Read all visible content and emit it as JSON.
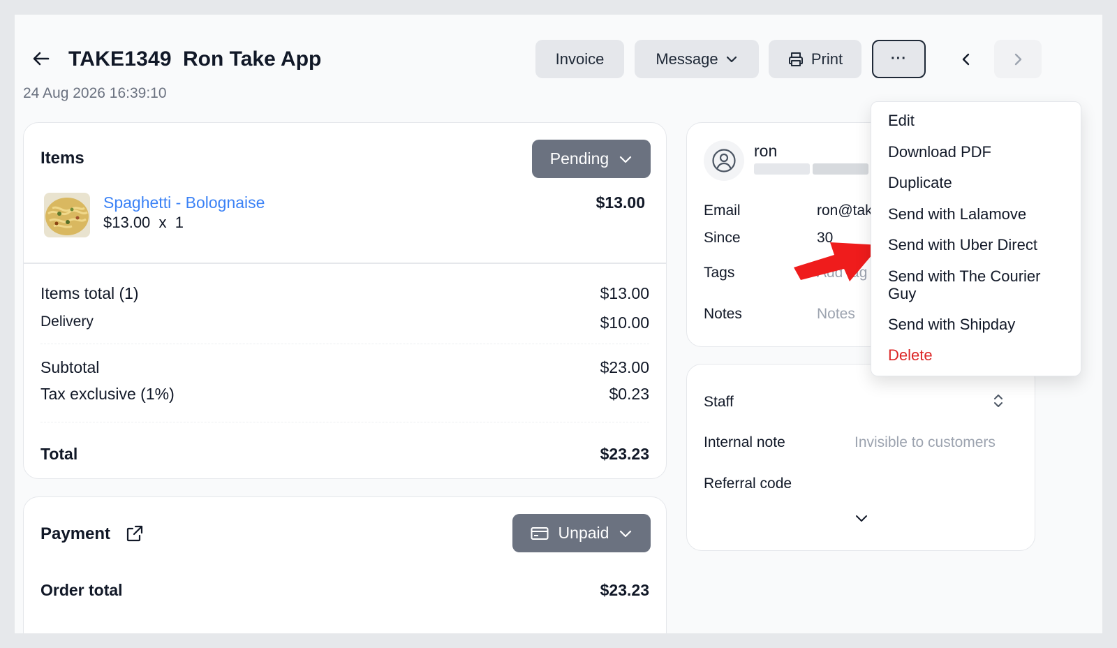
{
  "header": {
    "order_id": "TAKE1349",
    "customer_name": "Ron Take App",
    "date": "24 Aug 2026 16:39:10",
    "buttons": {
      "invoice": "Invoice",
      "message": "Message",
      "print": "Print",
      "more": "···"
    }
  },
  "items": {
    "title": "Items",
    "status": "Pending",
    "product": {
      "name": "Spaghetti - Bolognaise",
      "qty_line": "$13.00  x  1",
      "price": "$13.00"
    },
    "summary": {
      "items_total_label": "Items total (1)",
      "items_total_value": "$13.00",
      "delivery_label": "Delivery",
      "delivery_value": "$10.00",
      "subtotal_label": "Subtotal",
      "subtotal_value": "$23.00",
      "tax_label": "Tax exclusive (1%)",
      "tax_value": "$0.23",
      "total_label": "Total",
      "total_value": "$23.23"
    }
  },
  "payment": {
    "title": "Payment",
    "status": "Unpaid",
    "order_total_label": "Order total",
    "order_total_value": "$23.23"
  },
  "customer": {
    "name": "ron",
    "email_label": "Email",
    "email_value": "ron@tak",
    "since_label": "Since",
    "since_value": "30",
    "tags_label": "Tags",
    "tags_placeholder": "Add tag",
    "notes_label": "Notes",
    "notes_placeholder": "Notes"
  },
  "staff": {
    "staff_label": "Staff",
    "internal_note_label": "Internal note",
    "internal_note_placeholder": "Invisible to customers",
    "referral_label": "Referral code"
  },
  "more_menu": {
    "items": [
      "Edit",
      "Download PDF",
      "Duplicate",
      "Send with Lalamove",
      "Send with Uber Direct",
      "Send with The Courier Guy",
      "Send with Shipday",
      "Delete"
    ]
  },
  "colors": {
    "link": "#3b82f6",
    "status_button": "#6b7280",
    "danger": "#dc2626",
    "annotation_arrow": "#ef1c1c"
  }
}
